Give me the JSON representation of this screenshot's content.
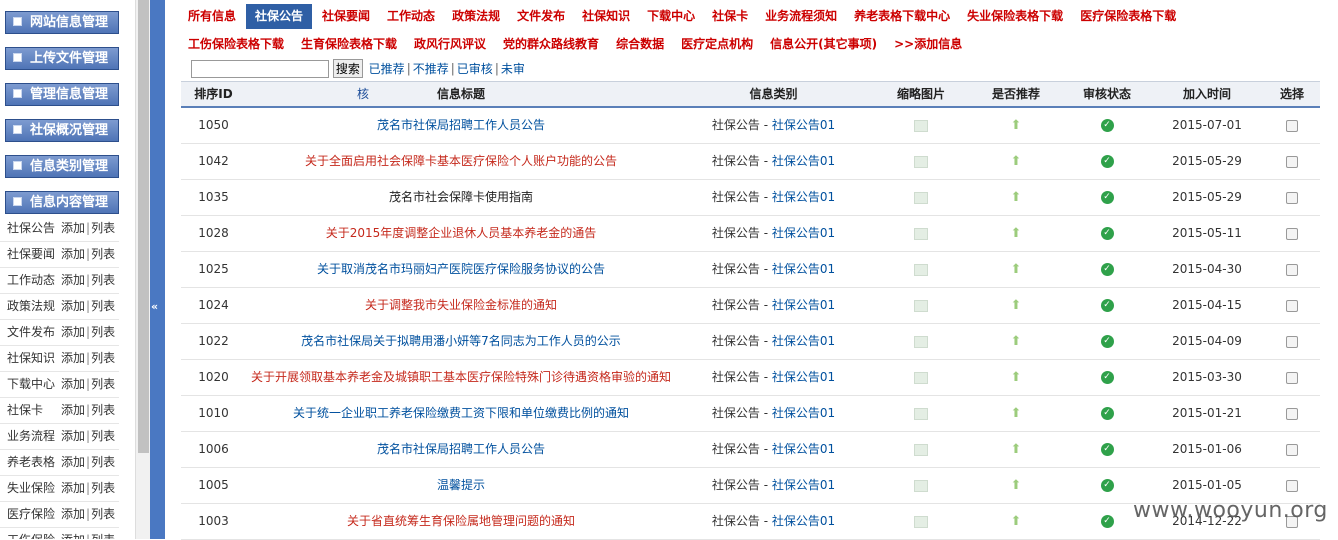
{
  "sidebar": {
    "headers": [
      "网站信息管理",
      "上传文件管理",
      "管理信息管理",
      "社保概况管理",
      "信息类别管理",
      "信息内容管理"
    ],
    "items": [
      {
        "label": "社保公告",
        "add": "添加",
        "sep": "|",
        "list": "列表"
      },
      {
        "label": "社保要闻",
        "add": "添加",
        "sep": "|",
        "list": "列表"
      },
      {
        "label": "工作动态",
        "add": "添加",
        "sep": "|",
        "list": "列表"
      },
      {
        "label": "政策法规",
        "add": "添加",
        "sep": "|",
        "list": "列表"
      },
      {
        "label": "文件发布",
        "add": "添加",
        "sep": "|",
        "list": "列表"
      },
      {
        "label": "社保知识",
        "add": "添加",
        "sep": "|",
        "list": "列表"
      },
      {
        "label": "下载中心",
        "add": "添加",
        "sep": "|",
        "list": "列表"
      },
      {
        "label": "社保卡",
        "add": "添加",
        "sep": "|",
        "list": "列表"
      },
      {
        "label": "业务流程",
        "add": "添加",
        "sep": "|",
        "list": "列表"
      },
      {
        "label": "养老表格",
        "add": "添加",
        "sep": "|",
        "list": "列表"
      },
      {
        "label": "失业保险",
        "add": "添加",
        "sep": "|",
        "list": "列表"
      },
      {
        "label": "医疗保险",
        "add": "添加",
        "sep": "|",
        "list": "列表"
      },
      {
        "label": "工伤保险",
        "add": "添加",
        "sep": "|",
        "list": "列表"
      }
    ]
  },
  "collapse_arrow": "«",
  "nav": {
    "row1": [
      "所有信息",
      "社保公告",
      "社保要闻",
      "工作动态",
      "政策法规",
      "文件发布",
      "社保知识",
      "下载中心",
      "社保卡",
      "业务流程须知",
      "养老表格下载中心",
      "失业保险表格下载",
      "医疗保险表格下载"
    ],
    "row2": [
      "工伤保险表格下载",
      "生育保险表格下载",
      "政风行风评议",
      "党的群众路线教育",
      "综合数据",
      "医疗定点机构",
      "信息公开(其它事项)",
      ">>添加信息"
    ],
    "active": "社保公告"
  },
  "search": {
    "placeholder": "",
    "button": "搜索",
    "filters": [
      "已推荐",
      "不推荐",
      "已审核",
      "未审"
    ],
    "sep": "|"
  },
  "table": {
    "headers": {
      "id": "排序ID",
      "check": "核",
      "title": "信息标题",
      "category": "信息类别",
      "thumb": "缩略图片",
      "recommend": "是否推荐",
      "audit": "审核状态",
      "date": "加入时间",
      "select": "选择"
    },
    "rows": [
      {
        "id": "1050",
        "title": "茂名市社保局招聘工作人员公告",
        "color": "blue",
        "cat_a": "社保公告 - ",
        "cat_b": "社保公告01",
        "date": "2015-07-01"
      },
      {
        "id": "1042",
        "title": "关于全面启用社会保障卡基本医疗保险个人账户功能的公告",
        "color": "red",
        "cat_a": "社保公告 - ",
        "cat_b": "社保公告01",
        "date": "2015-05-29"
      },
      {
        "id": "1035",
        "title": "茂名市社会保障卡使用指南",
        "color": "dark",
        "cat_a": "社保公告 - ",
        "cat_b": "社保公告01",
        "date": "2015-05-29"
      },
      {
        "id": "1028",
        "title": "关于2015年度调整企业退休人员基本养老金的通告",
        "color": "red",
        "cat_a": "社保公告 - ",
        "cat_b": "社保公告01",
        "date": "2015-05-11"
      },
      {
        "id": "1025",
        "title": "关于取消茂名市玛丽妇产医院医疗保险服务协议的公告",
        "color": "blue",
        "cat_a": "社保公告 - ",
        "cat_b": "社保公告01",
        "date": "2015-04-30"
      },
      {
        "id": "1024",
        "title": "关于调整我市失业保险金标准的通知",
        "color": "red",
        "cat_a": "社保公告 - ",
        "cat_b": "社保公告01",
        "date": "2015-04-15"
      },
      {
        "id": "1022",
        "title": "茂名市社保局关于拟聘用潘小妍等7名同志为工作人员的公示",
        "color": "blue",
        "cat_a": "社保公告 - ",
        "cat_b": "社保公告01",
        "date": "2015-04-09"
      },
      {
        "id": "1020",
        "title": "关于开展领取基本养老金及城镇职工基本医疗保险特殊门诊待遇资格审验的通知",
        "color": "red",
        "cat_a": "社保公告 - ",
        "cat_b": "社保公告01",
        "date": "2015-03-30"
      },
      {
        "id": "1010",
        "title": "关于统一企业职工养老保险缴费工资下限和单位缴费比例的通知",
        "color": "blue",
        "cat_a": "社保公告 - ",
        "cat_b": "社保公告01",
        "date": "2015-01-21"
      },
      {
        "id": "1006",
        "title": "茂名市社保局招聘工作人员公告",
        "color": "blue",
        "cat_a": "社保公告 - ",
        "cat_b": "社保公告01",
        "date": "2015-01-06"
      },
      {
        "id": "1005",
        "title": "温馨提示",
        "color": "blue",
        "cat_a": "社保公告 - ",
        "cat_b": "社保公告01",
        "date": "2015-01-05"
      },
      {
        "id": "1003",
        "title": "关于省直统筹生育保险属地管理问题的通知",
        "color": "red",
        "cat_a": "社保公告 - ",
        "cat_b": "社保公告01",
        "date": "2014-12-22"
      }
    ]
  },
  "icons": {
    "thumb": "image-icon",
    "recommend": "up-arrow-icon",
    "audit": "check-circle-icon"
  },
  "colors": {
    "nav_red": "#cc0000",
    "link_blue": "#00509e",
    "title_red": "#c5291c",
    "accent": "#2f5fa5"
  },
  "watermark": "www.wooyun.org"
}
